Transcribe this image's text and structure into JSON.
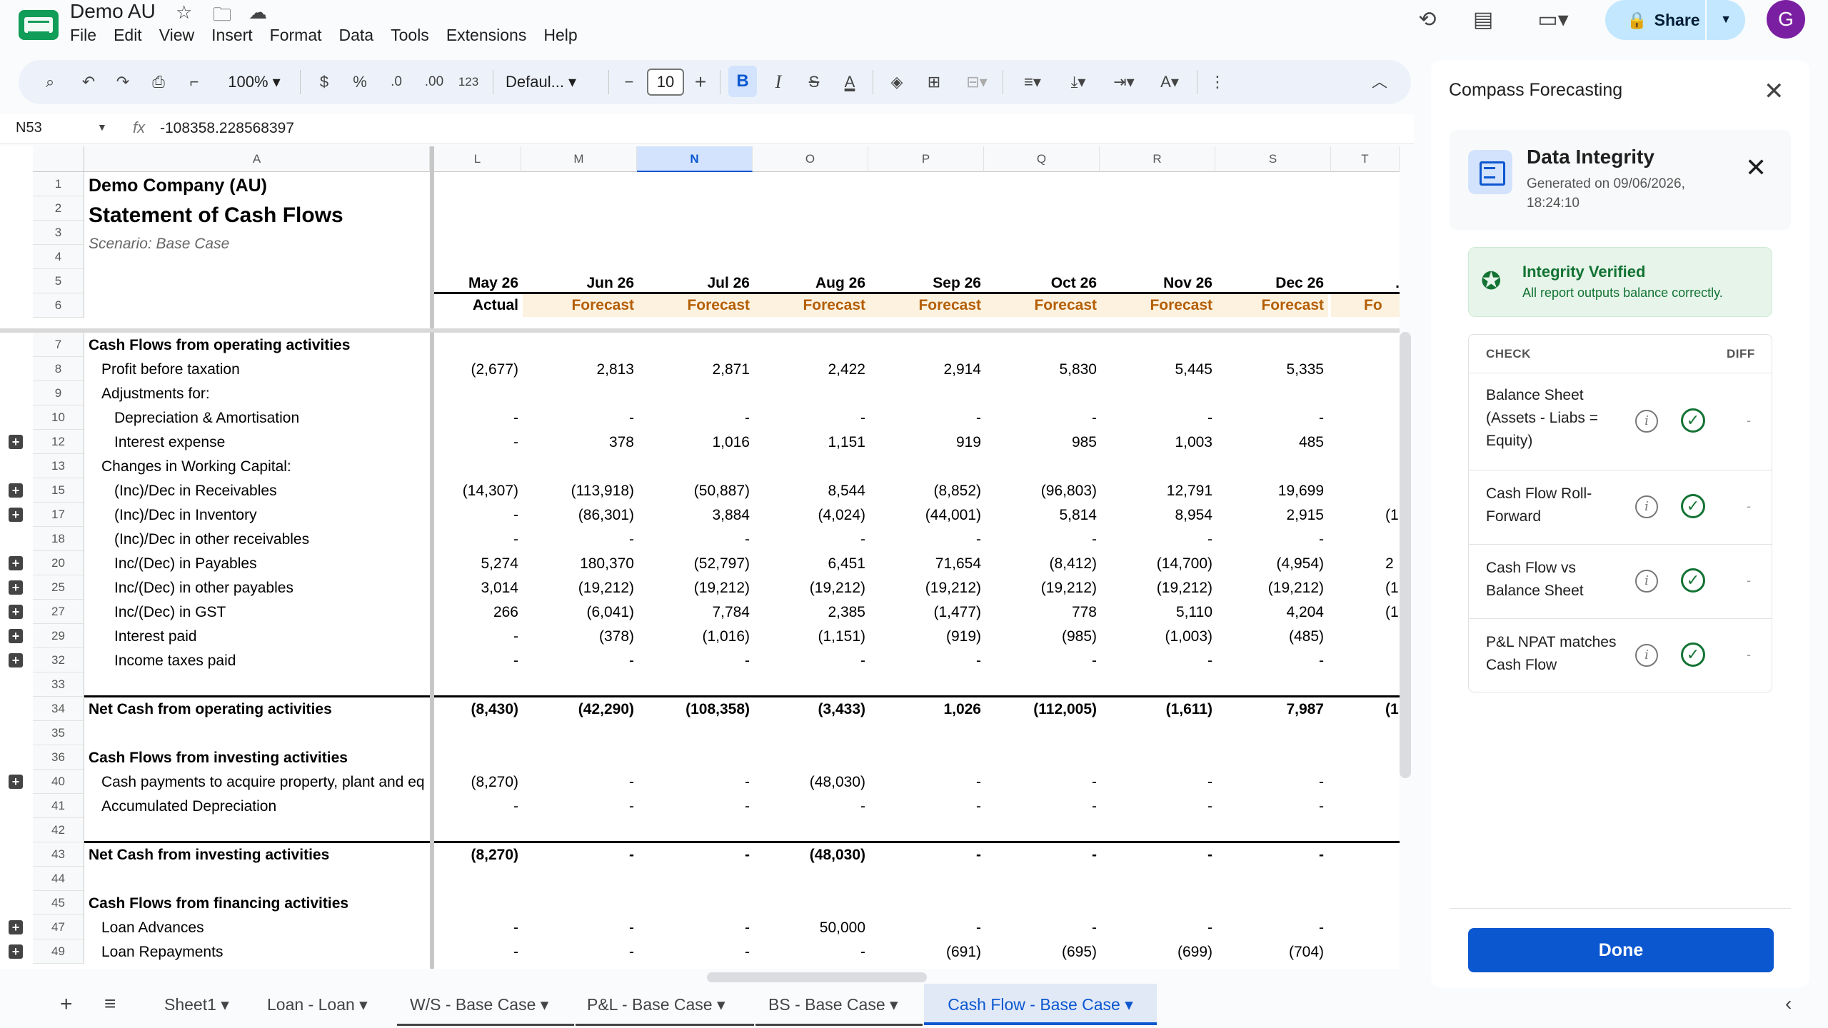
{
  "doc": {
    "title": "Demo AU"
  },
  "menu": [
    "File",
    "Edit",
    "View",
    "Insert",
    "Format",
    "Data",
    "Tools",
    "Extensions",
    "Help"
  ],
  "share": {
    "label": "Share"
  },
  "avatar": {
    "initial": "G"
  },
  "toolbar": {
    "zoom": "100%",
    "currency": "$",
    "percent": "%",
    "dec_decrease": ".0",
    "dec_increase": ".00",
    "format_123": "123",
    "font": "Defaul...",
    "font_size": "10",
    "bold": "B",
    "italic": "I",
    "strike": "S",
    "text_color": "A"
  },
  "formula_bar": {
    "cell_ref": "N53",
    "fx": "fx",
    "value": "-108358.228568397"
  },
  "columns": {
    "A": "A",
    "L": "L",
    "M": "M",
    "N": "N",
    "O": "O",
    "P": "P",
    "Q": "Q",
    "R": "R",
    "S": "S",
    "T": "T"
  },
  "sheet": {
    "company": "Demo Company (AU)",
    "title": "Statement of Cash Flows",
    "scenario": "Scenario: Base Case",
    "months": [
      "May 26",
      "Jun 26",
      "Jul 26",
      "Aug 26",
      "Sep 26",
      "Oct 26",
      "Nov 26",
      "Dec 26"
    ],
    "types": [
      "Actual",
      "Forecast",
      "Forecast",
      "Forecast",
      "Forecast",
      "Forecast",
      "Forecast",
      "Forecast"
    ],
    "overflow_t_type": "Fo",
    "rows": [
      {
        "n": "1",
        "label": "",
        "vals": []
      },
      {
        "n": "2",
        "label": "",
        "vals": []
      },
      {
        "n": "3",
        "label": "",
        "vals": []
      },
      {
        "n": "4",
        "label": "",
        "vals": []
      },
      {
        "n": "5",
        "label": "",
        "vals": []
      },
      {
        "n": "6",
        "label": "",
        "vals": []
      },
      {
        "n": "7",
        "label": "Cash Flows from operating activities",
        "bold": true,
        "vals": []
      },
      {
        "n": "8",
        "label": "Profit before taxation",
        "indent": 1,
        "vals": [
          "(2,677)",
          "2,813",
          "2,871",
          "2,422",
          "2,914",
          "5,830",
          "5,445",
          "5,335"
        ]
      },
      {
        "n": "9",
        "label": "Adjustments for:",
        "indent": 1,
        "vals": []
      },
      {
        "n": "10",
        "label": "Depreciation & Amortisation",
        "indent": 2,
        "vals": [
          "-",
          "-",
          "-",
          "-",
          "-",
          "-",
          "-",
          "-"
        ]
      },
      {
        "n": "12",
        "label": "Interest expense",
        "indent": 2,
        "expand": true,
        "vals": [
          "-",
          "378",
          "1,016",
          "1,151",
          "919",
          "985",
          "1,003",
          "485"
        ]
      },
      {
        "n": "13",
        "label": "Changes in Working Capital:",
        "indent": 1,
        "vals": []
      },
      {
        "n": "15",
        "label": "(Inc)/Dec in Receivables",
        "indent": 2,
        "expand": true,
        "vals": [
          "(14,307)",
          "(113,918)",
          "(50,887)",
          "8,544",
          "(8,852)",
          "(96,803)",
          "12,791",
          "19,699"
        ]
      },
      {
        "n": "17",
        "label": "(Inc)/Dec in Inventory",
        "indent": 2,
        "expand": true,
        "vals": [
          "-",
          "(86,301)",
          "3,884",
          "(4,024)",
          "(44,001)",
          "5,814",
          "8,954",
          "2,915"
        ],
        "t": "(1"
      },
      {
        "n": "18",
        "label": "(Inc)/Dec in other receivables",
        "indent": 2,
        "vals": [
          "-",
          "-",
          "-",
          "-",
          "-",
          "-",
          "-",
          "-"
        ]
      },
      {
        "n": "20",
        "label": "Inc/(Dec) in Payables",
        "indent": 2,
        "expand": true,
        "vals": [
          "5,274",
          "180,370",
          "(52,797)",
          "6,451",
          "71,654",
          "(8,412)",
          "(14,700)",
          "(4,954)"
        ],
        "t": "2"
      },
      {
        "n": "25",
        "label": "Inc/(Dec) in other payables",
        "indent": 2,
        "expand": true,
        "vals": [
          "3,014",
          "(19,212)",
          "(19,212)",
          "(19,212)",
          "(19,212)",
          "(19,212)",
          "(19,212)",
          "(19,212)"
        ],
        "t": "(1"
      },
      {
        "n": "27",
        "label": "Inc/(Dec) in GST",
        "indent": 2,
        "expand": true,
        "vals": [
          "266",
          "(6,041)",
          "7,784",
          "2,385",
          "(1,477)",
          "778",
          "5,110",
          "4,204"
        ],
        "t": "(1"
      },
      {
        "n": "29",
        "label": "Interest paid",
        "indent": 2,
        "expand": true,
        "vals": [
          "-",
          "(378)",
          "(1,016)",
          "(1,151)",
          "(919)",
          "(985)",
          "(1,003)",
          "(485)"
        ]
      },
      {
        "n": "32",
        "label": "Income taxes paid",
        "indent": 2,
        "expand": true,
        "vals": [
          "-",
          "-",
          "-",
          "-",
          "-",
          "-",
          "-",
          "-"
        ]
      },
      {
        "n": "33",
        "label": "",
        "vals": []
      },
      {
        "n": "34",
        "label": "Net Cash from operating activities",
        "bold": true,
        "topline": true,
        "vals": [
          "(8,430)",
          "(42,290)",
          "(108,358)",
          "(3,433)",
          "1,026",
          "(112,005)",
          "(1,611)",
          "7,987"
        ],
        "t": "(1"
      },
      {
        "n": "35",
        "label": "",
        "vals": []
      },
      {
        "n": "36",
        "label": "Cash Flows from investing activities",
        "bold": true,
        "vals": []
      },
      {
        "n": "40",
        "label": "Cash payments to acquire property, plant and eq",
        "indent": 1,
        "expand": true,
        "vals": [
          "(8,270)",
          "-",
          "-",
          "(48,030)",
          "-",
          "-",
          "-",
          "-"
        ]
      },
      {
        "n": "41",
        "label": "Accumulated Depreciation",
        "indent": 1,
        "vals": [
          "-",
          "-",
          "-",
          "-",
          "-",
          "-",
          "-",
          "-"
        ]
      },
      {
        "n": "42",
        "label": "",
        "vals": []
      },
      {
        "n": "43",
        "label": "Net Cash from investing activities",
        "bold": true,
        "topline": true,
        "vals": [
          "(8,270)",
          "-",
          "-",
          "(48,030)",
          "-",
          "-",
          "-",
          "-"
        ]
      },
      {
        "n": "44",
        "label": "",
        "vals": []
      },
      {
        "n": "45",
        "label": "Cash Flows from financing activities",
        "bold": true,
        "vals": []
      },
      {
        "n": "47",
        "label": "Loan Advances",
        "indent": 1,
        "expand": true,
        "vals": [
          "-",
          "-",
          "-",
          "50,000",
          "-",
          "-",
          "-",
          "-"
        ]
      },
      {
        "n": "49",
        "label": "Loan Repayments",
        "indent": 1,
        "expand": true,
        "vals": [
          "-",
          "-",
          "-",
          "-",
          "(691)",
          "(695)",
          "(699)",
          "(704)"
        ]
      }
    ]
  },
  "tabs": [
    "Sheet1",
    "Loan - Loan",
    "W/S - Base Case",
    "P&L - Base Case",
    "BS - Base Case",
    "Cash Flow - Base Case"
  ],
  "panel": {
    "title": "Compass Forecasting",
    "di_title": "Data Integrity",
    "di_generated": "Generated on 09/06/2026, 18:24:10",
    "verified_title": "Integrity Verified",
    "verified_sub": "All report outputs balance correctly.",
    "th_check": "CHECK",
    "th_diff": "DIFF",
    "checks": [
      {
        "label": "Balance Sheet (Assets - Liabs = Equity)",
        "diff": "-"
      },
      {
        "label": "Cash Flow Roll-Forward",
        "diff": "-"
      },
      {
        "label": "Cash Flow vs Balance Sheet",
        "diff": "-"
      },
      {
        "label": "P&L NPAT matches Cash Flow",
        "diff": "-"
      }
    ],
    "done_label": "Done"
  },
  "colors": {
    "accent": "#0b57d0",
    "forecast": "#b45f06",
    "verified": "#137333"
  }
}
